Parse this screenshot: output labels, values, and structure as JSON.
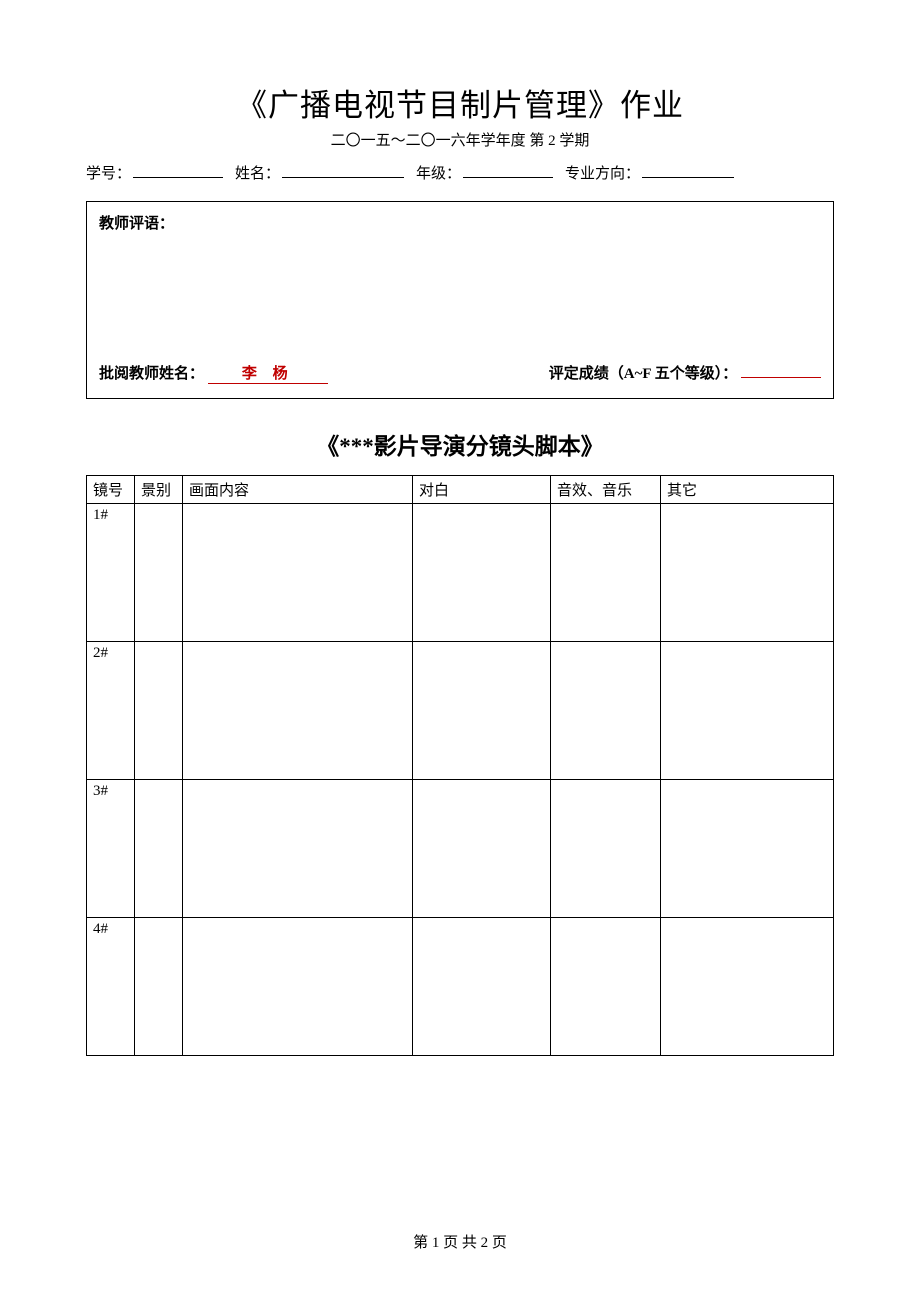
{
  "header": {
    "title": "《广播电视节目制片管理》作业",
    "subtitle": "二〇一五～二〇一六年学年度  第 2 学期",
    "fields": {
      "student_id_label": "学号：",
      "name_label": "姓名：",
      "grade_label": "年级：",
      "major_label": "专业方向："
    }
  },
  "comment_box": {
    "comment_label": "教师评语：",
    "teacher_label": "批阅教师姓名：",
    "teacher_name": "李  杨",
    "grade_label": "评定成绩（A~F 五个等级）："
  },
  "script": {
    "title": "《***影片导演分镜头脚本》",
    "headers": {
      "shot": "镜号",
      "view": "景别",
      "content": "画面内容",
      "dialog": "对白",
      "sound": "音效、音乐",
      "other": "其它"
    },
    "rows": [
      {
        "shot": "1#",
        "view": "",
        "content": "",
        "dialog": "",
        "sound": "",
        "other": ""
      },
      {
        "shot": "2#",
        "view": "",
        "content": "",
        "dialog": "",
        "sound": "",
        "other": ""
      },
      {
        "shot": "3#",
        "view": "",
        "content": "",
        "dialog": "",
        "sound": "",
        "other": ""
      },
      {
        "shot": "4#",
        "view": "",
        "content": "",
        "dialog": "",
        "sound": "",
        "other": ""
      }
    ]
  },
  "footer": {
    "text": "第 1 页   共 2 页"
  }
}
